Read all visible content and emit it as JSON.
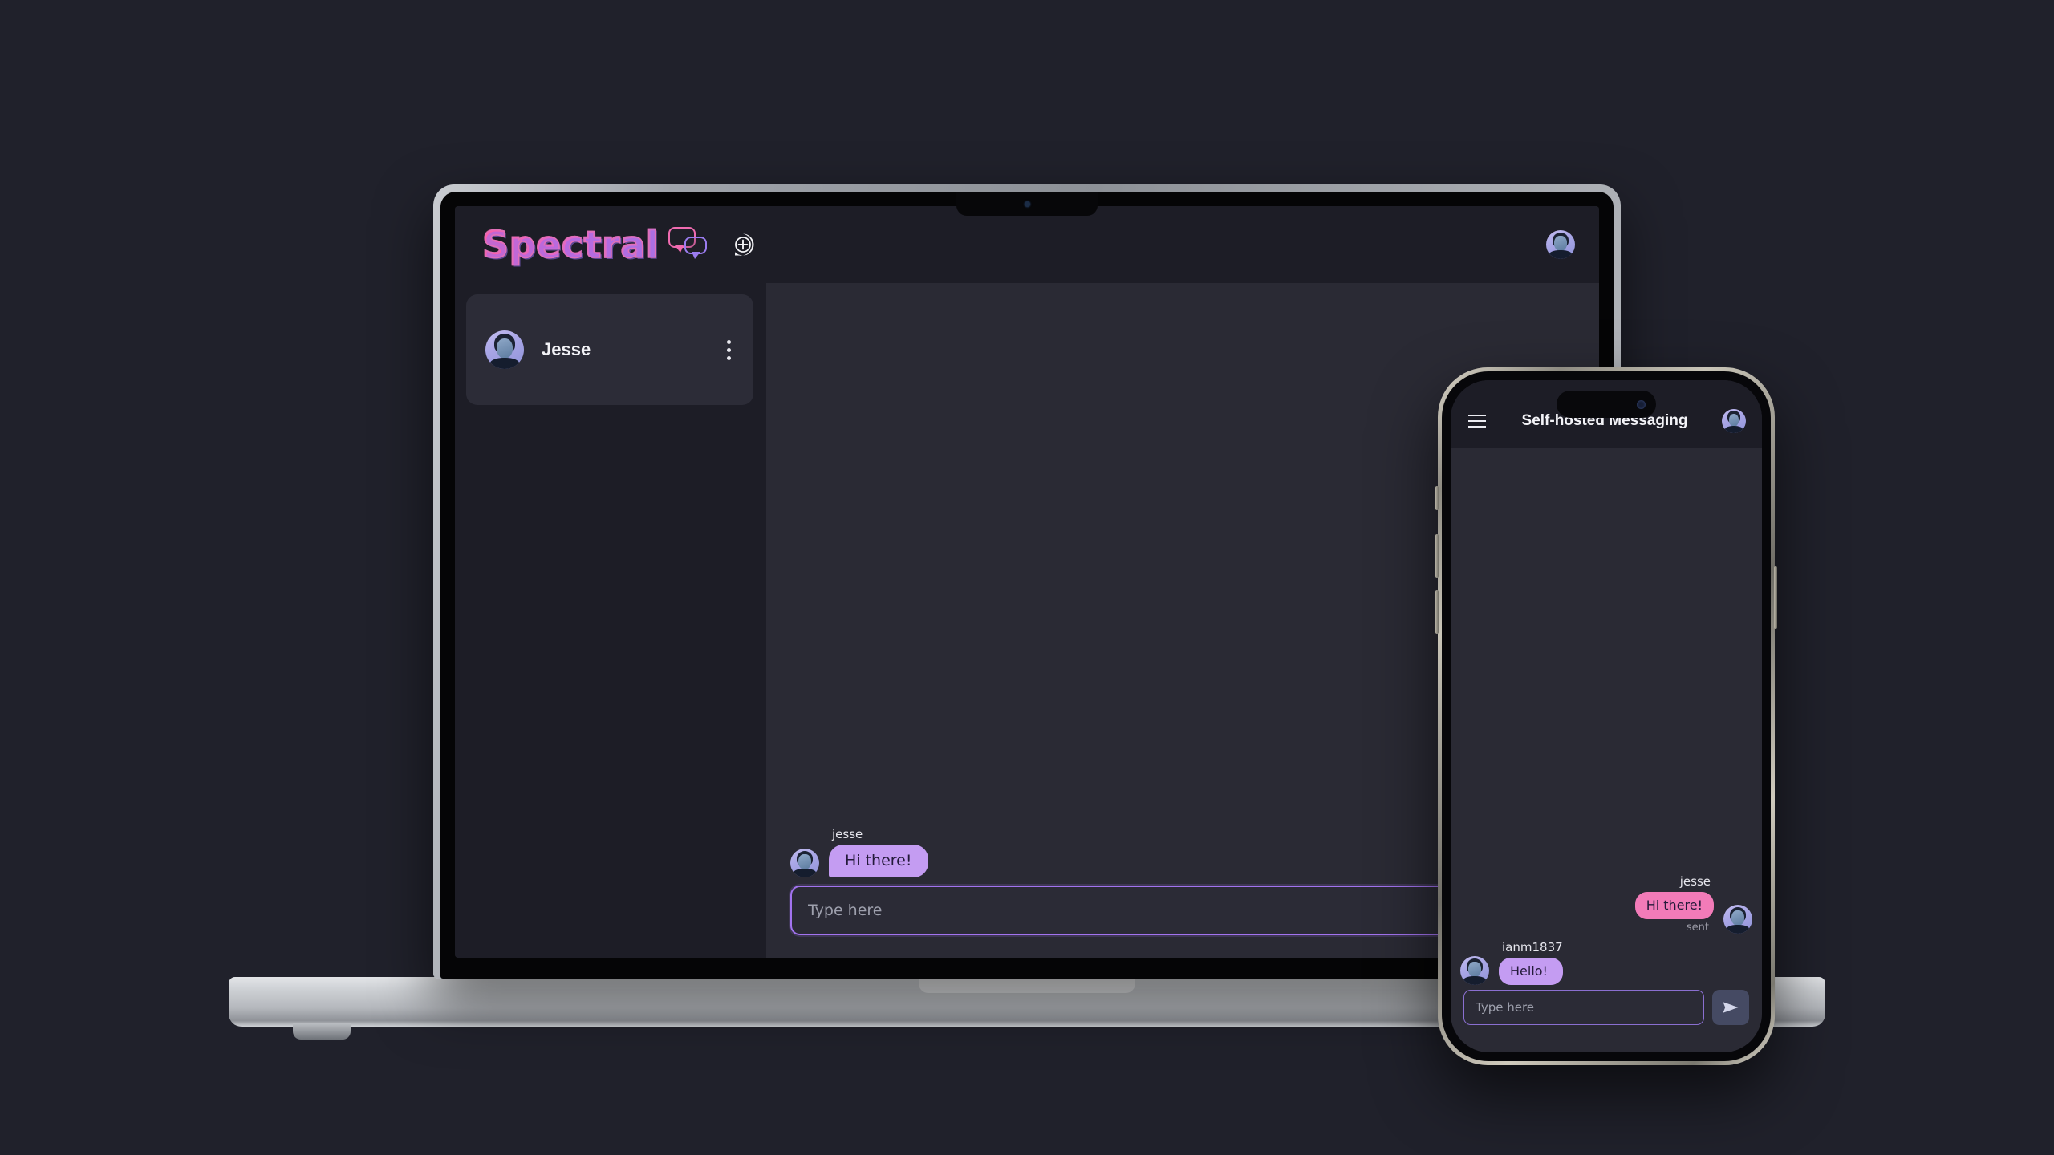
{
  "theme": {
    "page_bg": "#20212b",
    "app_bg": "#2a2a34",
    "panel_bg": "#1d1d26",
    "card_bg": "#2c2c37",
    "accent_purple": "#a273ef",
    "bubble_purple": "#c49cf2",
    "bubble_pink": "#f27bb8",
    "text_primary": "#f2f2f6",
    "text_muted": "#9ea0ad"
  },
  "laptop": {
    "header": {
      "logo_text": "Spectral",
      "logo_bubbles_icon": "chat-bubbles-icon",
      "new_chat_icon": "new-chat-plus-icon",
      "account_avatar": "user-avatar"
    },
    "sidebar": {
      "conversations": [
        {
          "name": "Jesse",
          "avatar": "user-avatar",
          "menu_icon": "kebab-menu-icon"
        }
      ]
    },
    "chat": {
      "messages": [
        {
          "username": "jesse",
          "text": "Hi there!",
          "direction": "incoming",
          "bubble_color": "#c49cf2"
        }
      ],
      "composer": {
        "placeholder": "Type here",
        "value": ""
      }
    }
  },
  "phone": {
    "header": {
      "menu_icon": "hamburger-menu-icon",
      "title": "Self-hosted Messaging",
      "account_avatar": "user-avatar"
    },
    "chat": {
      "messages": [
        {
          "username": "jesse",
          "text": "Hi there!",
          "direction": "outgoing",
          "status": "sent",
          "bubble_color": "#f27bb8"
        },
        {
          "username": "ianm1837",
          "text": "Hello!",
          "direction": "incoming",
          "status": "",
          "bubble_color": "#c49cf2"
        }
      ],
      "composer": {
        "placeholder": "Type here",
        "value": "",
        "send_icon": "send-paper-plane-icon"
      }
    }
  }
}
